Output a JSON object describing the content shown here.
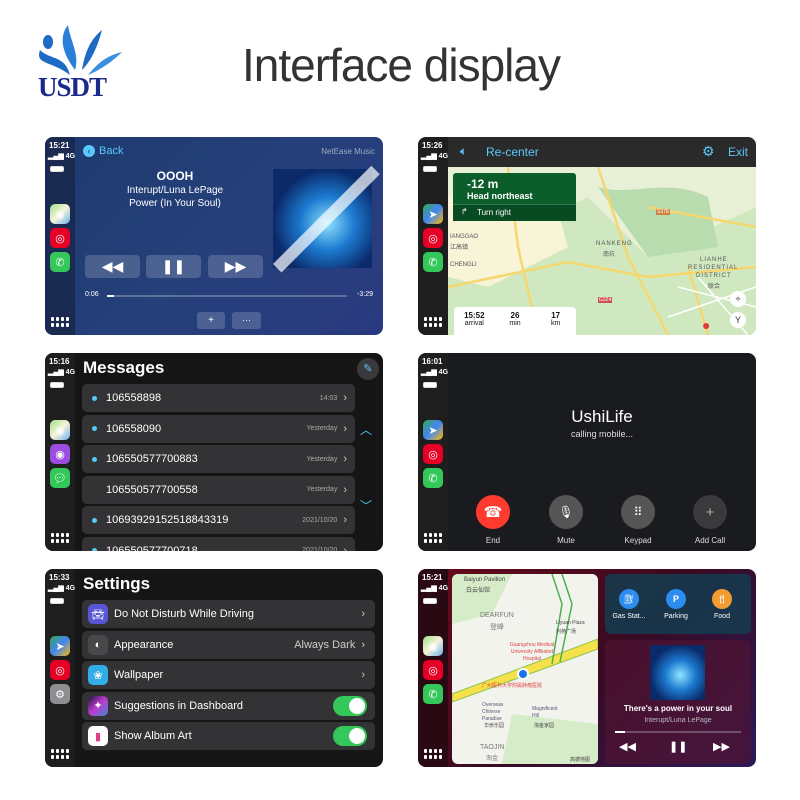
{
  "header": {
    "logo_text": "USDT",
    "title": "Interface display"
  },
  "colors": {
    "accent": "#5ac8fa",
    "green_toggle": "#34c759",
    "end_red": "#ff3b30",
    "nav_green": "#0b5e2a"
  },
  "music": {
    "time": "15:21",
    "signal": "4G",
    "back": "Back",
    "app_name": "NetEase Music",
    "song": "OOOH",
    "artist": "Interupt/Luna LePage",
    "album": "Power (In Your Soul)",
    "elapsed": "0:06",
    "remaining": "-3:29",
    "progress_percent": 3,
    "add": "+",
    "more": "···",
    "apps": [
      "maps",
      "netease-music",
      "phone"
    ]
  },
  "nav": {
    "time": "15:26",
    "signal": "4G",
    "recenter": "Re-center",
    "exit": "Exit",
    "distance": "-12 m",
    "instruction": "Head northeast",
    "next": "Turn right",
    "eta": [
      {
        "value": "15:52",
        "label": "arrival"
      },
      {
        "value": "26",
        "label": "min"
      },
      {
        "value": "17",
        "label": "km"
      }
    ],
    "map_labels": [
      "NANKENG",
      "南坑",
      "LIANHE",
      "RESIDENTIAL",
      "DISTRICT",
      "联合",
      "IANGGAO",
      "江高镇",
      "CHENGLI",
      "S378",
      "G324"
    ],
    "apps": [
      "google-maps",
      "netease-music",
      "phone"
    ]
  },
  "messages": {
    "time": "15:16",
    "signal": "4G",
    "title": "Messages",
    "items": [
      {
        "name": "106558898",
        "time": "14:03",
        "unread": true
      },
      {
        "name": "106558090",
        "time": "Yesterday",
        "unread": true
      },
      {
        "name": "106550577700883",
        "time": "Yesterday",
        "unread": true
      },
      {
        "name": "106550577700558",
        "time": "Yesterday",
        "unread": false
      },
      {
        "name": "10693929152518843319",
        "time": "2021/10/20",
        "unread": true
      },
      {
        "name": "106550577700718",
        "time": "2021/10/20",
        "unread": true
      }
    ],
    "apps": [
      "maps",
      "podcasts",
      "messages"
    ]
  },
  "call": {
    "time": "16:01",
    "signal": "4G",
    "name": "UshiLife",
    "status": "calling mobile...",
    "buttons": [
      "End",
      "Mute",
      "Keypad",
      "Add Call"
    ],
    "apps": [
      "google-maps",
      "netease-music",
      "phone"
    ]
  },
  "settings": {
    "time": "15:33",
    "signal": "4G",
    "title": "Settings",
    "items": [
      {
        "label": "Do Not Disturb While Driving",
        "value": "",
        "type": "link"
      },
      {
        "label": "Appearance",
        "value": "Always Dark",
        "type": "link"
      },
      {
        "label": "Wallpaper",
        "value": "",
        "type": "link"
      },
      {
        "label": "Suggestions in Dashboard",
        "value": "",
        "type": "toggle",
        "on": true
      },
      {
        "label": "Show Album Art",
        "value": "",
        "type": "toggle",
        "on": true
      }
    ],
    "apps": [
      "google-maps",
      "netease-music",
      "settings"
    ]
  },
  "dashboard": {
    "time": "15:21",
    "signal": "4G",
    "poi": [
      "Gas Stat...",
      "Parking",
      "Food"
    ],
    "song": "There's a power in your soul",
    "artist": "Interupt/Luna LePage",
    "progress_percent": 8,
    "map_labels": [
      "Baiyun Pavilion",
      "白云仙馆",
      "DEARFUN",
      "登峰",
      "Liyuan Plaza",
      "利苑广场",
      "Guangzhou Medical University Affiliated Hospital",
      "广州医科大学附属肿瘤医院",
      "Overseas Chinese Paradise",
      "华侨乐园",
      "Magnificent Hill",
      "淘金家园",
      "TAOJIN",
      "淘金",
      "高德地图"
    ],
    "apps": [
      "maps",
      "netease-music",
      "phone"
    ]
  }
}
